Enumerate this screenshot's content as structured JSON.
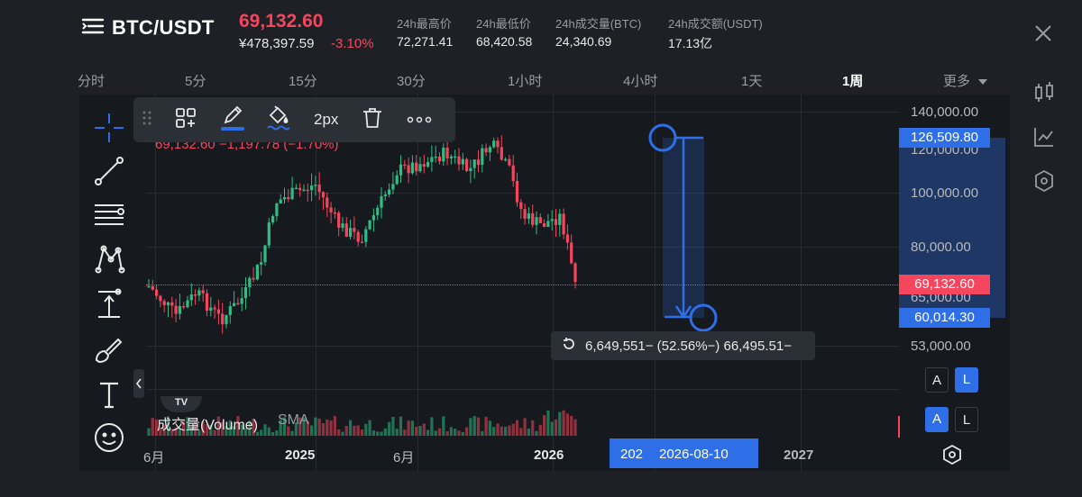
{
  "header": {
    "pair": "BTC/USDT",
    "price": "69,132.60",
    "price_cny": "¥478,397.59",
    "change_pct": "-3.10%",
    "stats": [
      {
        "label": "24h最高价",
        "value": "72,271.41"
      },
      {
        "label": "24h最低价",
        "value": "68,420.58"
      },
      {
        "label": "24h成交量(BTC)",
        "value": "24,340.69"
      },
      {
        "label": "24h成交额(USDT)",
        "value": "17.13亿"
      }
    ]
  },
  "tabs": [
    "分时",
    "5分",
    "15分",
    "30分",
    "1小时",
    "4小时",
    "1天",
    "1周",
    "更多"
  ],
  "active_tab": "1周",
  "drawing_toolbar": {
    "width_label": "2px"
  },
  "chart": {
    "ohlc_text": "69,132.60  −1,197.78 (−1.70%)",
    "y_labels": [
      "140,000.00",
      "120,000.00",
      "100,000.00",
      "80,000.00",
      "65,000.00",
      "53,000.00"
    ],
    "x_labels": [
      "6月",
      "2025",
      "6月",
      "2026",
      "2027"
    ],
    "current_price_tag": "69,132.60",
    "measure_top_tag": "126,509.80",
    "measure_bottom_tag": "60,014.30",
    "measure_readout": "−66,495.51 (−52.56%) −6,649,551",
    "date_tag_partial": "202",
    "date_tag": "2026-08-10",
    "volume_label": "成交量(Volume)",
    "volume_sma": "SMA",
    "indicator_watermark": "TV"
  },
  "scale_buttons": {
    "top": [
      "A",
      "L"
    ],
    "bottom": [
      "A",
      "L"
    ]
  },
  "colors": {
    "up": "#2ebd85",
    "down": "#f6465d",
    "accent": "#2e6fe8",
    "background": "#161a1e"
  }
}
